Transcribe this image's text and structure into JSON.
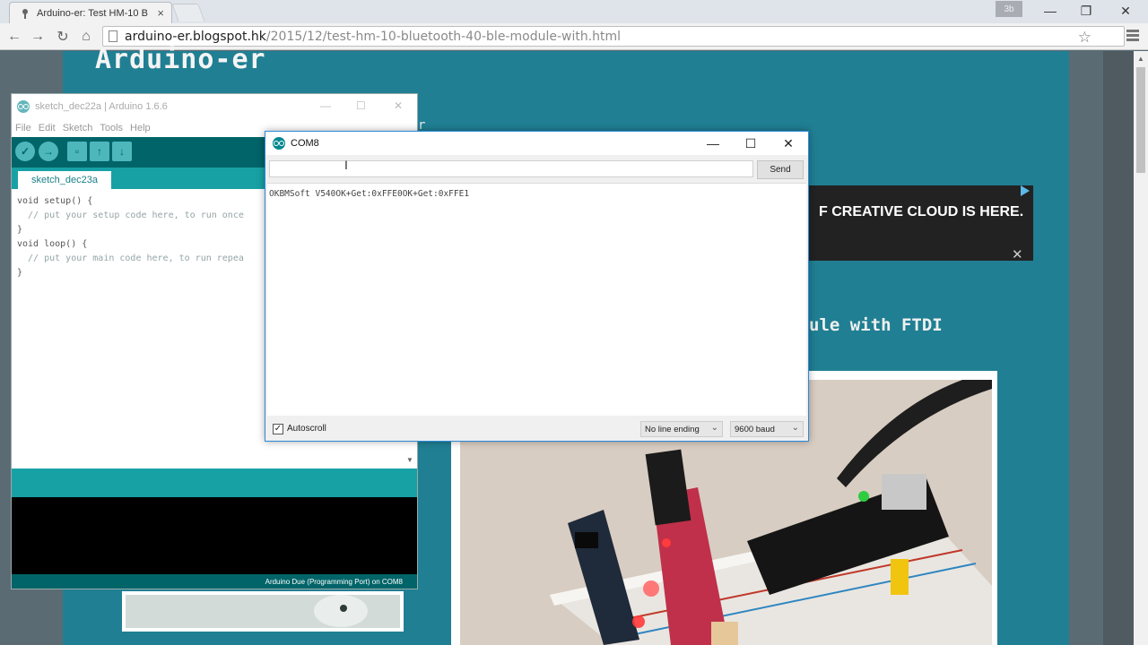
{
  "browser": {
    "tab_title": "Arduino-er: Test HM-10 B",
    "tab_close": "×",
    "profile_label": "3b",
    "url_host": "arduino-er.blogspot.hk",
    "url_path": "/2015/12/test-hm-10-bluetooth-40-ble-module-with.html",
    "icons": {
      "back": "←",
      "forward": "→",
      "reload": "↻",
      "home": "⌂",
      "star": "☆",
      "minimize": "—",
      "restore": "❐",
      "close": "✕"
    }
  },
  "blog": {
    "title": "Arduino-er",
    "header_fragment": "r",
    "ad_text": "F CREATIVE CLOUD IS HERE.",
    "post_heading_fragment": "ule with FTDI"
  },
  "ide": {
    "title": "sketch_dec22a | Arduino 1.6.6",
    "menu": [
      "File",
      "Edit",
      "Sketch",
      "Tools",
      "Help"
    ],
    "tab_label": "sketch_dec23a",
    "code_lines": [
      "void setup() {",
      "  // put your setup code here, to run once",
      "",
      "}",
      "",
      "void loop() {",
      "  // put your main code here, to run repea",
      "",
      "}"
    ],
    "status": "Arduino Due (Programming Port) on COM8",
    "controls": {
      "minimize": "—",
      "maximize": "☐",
      "close": "✕"
    }
  },
  "serial": {
    "title": "COM8",
    "input_value": "",
    "send_label": "Send",
    "output": "OKBMSoft V540OK+Get:0xFFE0OK+Get:0xFFE1",
    "autoscroll_label": "Autoscroll",
    "autoscroll_checked": "✓",
    "line_ending": "No line ending",
    "baud": "9600 baud",
    "controls": {
      "minimize": "—",
      "maximize": "☐",
      "close": "✕"
    }
  },
  "colors": {
    "arduino_teal": "#006468",
    "arduino_light": "#17a1a5",
    "blog_bg": "#207f93"
  }
}
